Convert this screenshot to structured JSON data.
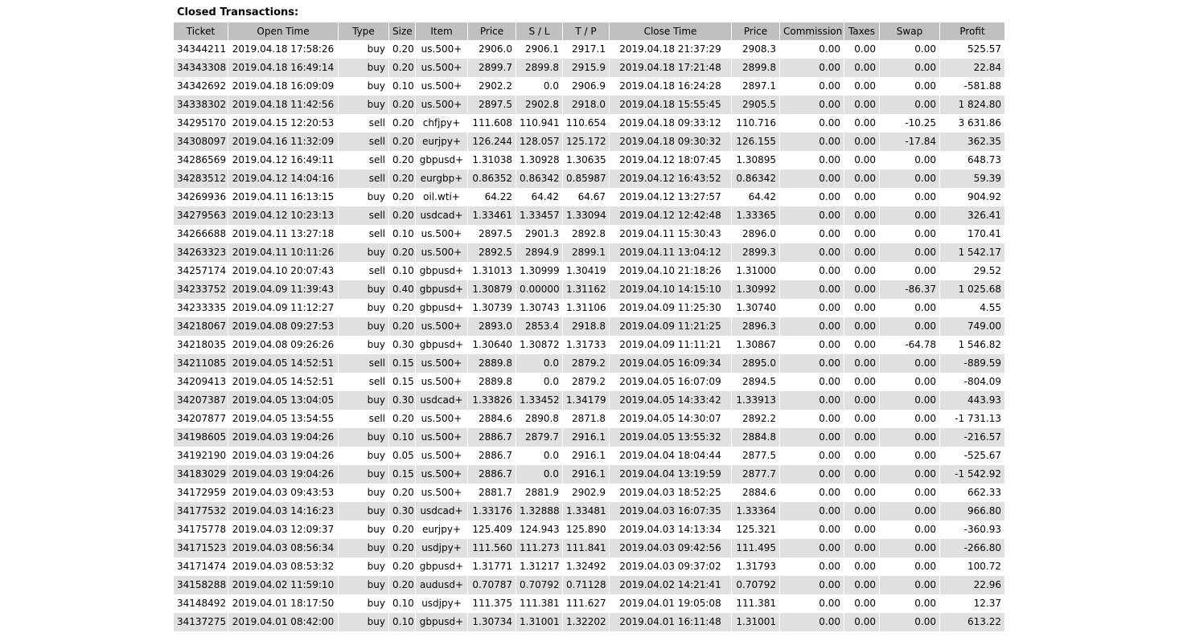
{
  "section_title": "Closed Transactions:",
  "columns": [
    "Ticket",
    "Open Time",
    "Type",
    "Size",
    "Item",
    "Price",
    "S / L",
    "T / P",
    "Close Time",
    "Price",
    "Commission",
    "Taxes",
    "Swap",
    "Profit"
  ],
  "rows": [
    [
      "34344211",
      "2019.04.18 17:58:26",
      "buy",
      "0.20",
      "us.500+",
      "2906.0",
      "2906.1",
      "2917.1",
      "2019.04.18 21:37:29",
      "2908.3",
      "0.00",
      "0.00",
      "0.00",
      "525.57"
    ],
    [
      "34343308",
      "2019.04.18 16:49:14",
      "buy",
      "0.20",
      "us.500+",
      "2899.7",
      "2899.8",
      "2915.9",
      "2019.04.18 17:21:48",
      "2899.8",
      "0.00",
      "0.00",
      "0.00",
      "22.84"
    ],
    [
      "34342692",
      "2019.04.18 16:09:09",
      "buy",
      "0.10",
      "us.500+",
      "2902.2",
      "0.0",
      "2906.9",
      "2019.04.18 16:24:28",
      "2897.1",
      "0.00",
      "0.00",
      "0.00",
      "-581.88"
    ],
    [
      "34338302",
      "2019.04.18 11:42:56",
      "buy",
      "0.20",
      "us.500+",
      "2897.5",
      "2902.8",
      "2918.0",
      "2019.04.18 15:55:45",
      "2905.5",
      "0.00",
      "0.00",
      "0.00",
      "1 824.80"
    ],
    [
      "34295170",
      "2019.04.15 12:20:53",
      "sell",
      "0.20",
      "chfjpy+",
      "111.608",
      "110.941",
      "110.654",
      "2019.04.18 09:33:12",
      "110.716",
      "0.00",
      "0.00",
      "-10.25",
      "3 631.86"
    ],
    [
      "34308097",
      "2019.04.16 11:32:09",
      "sell",
      "0.20",
      "eurjpy+",
      "126.244",
      "128.057",
      "125.172",
      "2019.04.18 09:30:32",
      "126.155",
      "0.00",
      "0.00",
      "-17.84",
      "362.35"
    ],
    [
      "34286569",
      "2019.04.12 16:49:11",
      "sell",
      "0.20",
      "gbpusd+",
      "1.31038",
      "1.30928",
      "1.30635",
      "2019.04.12 18:07:45",
      "1.30895",
      "0.00",
      "0.00",
      "0.00",
      "648.73"
    ],
    [
      "34283512",
      "2019.04.12 14:04:16",
      "sell",
      "0.20",
      "eurgbp+",
      "0.86352",
      "0.86342",
      "0.85987",
      "2019.04.12 16:43:52",
      "0.86342",
      "0.00",
      "0.00",
      "0.00",
      "59.39"
    ],
    [
      "34269936",
      "2019.04.11 16:13:15",
      "buy",
      "0.20",
      "oil.wti+",
      "64.22",
      "64.42",
      "64.67",
      "2019.04.12 13:27:57",
      "64.42",
      "0.00",
      "0.00",
      "0.00",
      "904.92"
    ],
    [
      "34279563",
      "2019.04.12 10:23:13",
      "sell",
      "0.20",
      "usdcad+",
      "1.33461",
      "1.33457",
      "1.33094",
      "2019.04.12 12:42:48",
      "1.33365",
      "0.00",
      "0.00",
      "0.00",
      "326.41"
    ],
    [
      "34266688",
      "2019.04.11 13:27:18",
      "sell",
      "0.10",
      "us.500+",
      "2897.5",
      "2901.3",
      "2892.8",
      "2019.04.11 15:30:43",
      "2896.0",
      "0.00",
      "0.00",
      "0.00",
      "170.41"
    ],
    [
      "34263323",
      "2019.04.11 10:11:26",
      "buy",
      "0.20",
      "us.500+",
      "2892.5",
      "2894.9",
      "2899.1",
      "2019.04.11 13:04:12",
      "2899.3",
      "0.00",
      "0.00",
      "0.00",
      "1 542.17"
    ],
    [
      "34257174",
      "2019.04.10 20:07:43",
      "sell",
      "0.10",
      "gbpusd+",
      "1.31013",
      "1.30999",
      "1.30419",
      "2019.04.10 21:18:26",
      "1.31000",
      "0.00",
      "0.00",
      "0.00",
      "29.52"
    ],
    [
      "34233752",
      "2019.04.09 11:39:43",
      "buy",
      "0.40",
      "gbpusd+",
      "1.30879",
      "0.00000",
      "1.31162",
      "2019.04.10 14:15:10",
      "1.30992",
      "0.00",
      "0.00",
      "-86.37",
      "1 025.68"
    ],
    [
      "34233335",
      "2019.04.09 11:12:27",
      "buy",
      "0.20",
      "gbpusd+",
      "1.30739",
      "1.30743",
      "1.31106",
      "2019.04.09 11:25:30",
      "1.30740",
      "0.00",
      "0.00",
      "0.00",
      "4.55"
    ],
    [
      "34218067",
      "2019.04.08 09:27:53",
      "buy",
      "0.20",
      "us.500+",
      "2893.0",
      "2853.4",
      "2918.8",
      "2019.04.09 11:21:25",
      "2896.3",
      "0.00",
      "0.00",
      "0.00",
      "749.00"
    ],
    [
      "34218035",
      "2019.04.08 09:26:26",
      "buy",
      "0.30",
      "gbpusd+",
      "1.30640",
      "1.30872",
      "1.31733",
      "2019.04.09 11:11:21",
      "1.30867",
      "0.00",
      "0.00",
      "-64.78",
      "1 546.82"
    ],
    [
      "34211085",
      "2019.04.05 14:52:51",
      "sell",
      "0.15",
      "us.500+",
      "2889.8",
      "0.0",
      "2879.2",
      "2019.04.05 16:09:34",
      "2895.0",
      "0.00",
      "0.00",
      "0.00",
      "-889.59"
    ],
    [
      "34209413",
      "2019.04.05 14:52:51",
      "sell",
      "0.15",
      "us.500+",
      "2889.8",
      "0.0",
      "2879.2",
      "2019.04.05 16:07:09",
      "2894.5",
      "0.00",
      "0.00",
      "0.00",
      "-804.09"
    ],
    [
      "34207387",
      "2019.04.05 13:04:05",
      "buy",
      "0.30",
      "usdcad+",
      "1.33826",
      "1.33452",
      "1.34179",
      "2019.04.05 14:33:42",
      "1.33913",
      "0.00",
      "0.00",
      "0.00",
      "443.93"
    ],
    [
      "34207877",
      "2019.04.05 13:54:55",
      "sell",
      "0.20",
      "us.500+",
      "2884.6",
      "2890.8",
      "2871.8",
      "2019.04.05 14:30:07",
      "2892.2",
      "0.00",
      "0.00",
      "0.00",
      "-1 731.13"
    ],
    [
      "34198605",
      "2019.04.03 19:04:26",
      "buy",
      "0.10",
      "us.500+",
      "2886.7",
      "2879.7",
      "2916.1",
      "2019.04.05 13:55:32",
      "2884.8",
      "0.00",
      "0.00",
      "0.00",
      "-216.57"
    ],
    [
      "34192190",
      "2019.04.03 19:04:26",
      "buy",
      "0.05",
      "us.500+",
      "2886.7",
      "0.0",
      "2916.1",
      "2019.04.04 18:04:44",
      "2877.5",
      "0.00",
      "0.00",
      "0.00",
      "-525.67"
    ],
    [
      "34183029",
      "2019.04.03 19:04:26",
      "buy",
      "0.15",
      "us.500+",
      "2886.7",
      "0.0",
      "2916.1",
      "2019.04.04 13:19:59",
      "2877.7",
      "0.00",
      "0.00",
      "0.00",
      "-1 542.92"
    ],
    [
      "34172959",
      "2019.04.03 09:43:53",
      "buy",
      "0.20",
      "us.500+",
      "2881.7",
      "2881.9",
      "2902.9",
      "2019.04.03 18:52:25",
      "2884.6",
      "0.00",
      "0.00",
      "0.00",
      "662.33"
    ],
    [
      "34177532",
      "2019.04.03 14:16:23",
      "buy",
      "0.30",
      "usdcad+",
      "1.33176",
      "1.32888",
      "1.33481",
      "2019.04.03 16:07:35",
      "1.33364",
      "0.00",
      "0.00",
      "0.00",
      "966.80"
    ],
    [
      "34175778",
      "2019.04.03 12:09:37",
      "buy",
      "0.20",
      "eurjpy+",
      "125.409",
      "124.943",
      "125.890",
      "2019.04.03 14:13:34",
      "125.321",
      "0.00",
      "0.00",
      "0.00",
      "-360.93"
    ],
    [
      "34171523",
      "2019.04.03 08:56:34",
      "buy",
      "0.20",
      "usdjpy+",
      "111.560",
      "111.273",
      "111.841",
      "2019.04.03 09:42:56",
      "111.495",
      "0.00",
      "0.00",
      "0.00",
      "-266.80"
    ],
    [
      "34171474",
      "2019.04.03 08:53:32",
      "buy",
      "0.20",
      "gbpusd+",
      "1.31771",
      "1.31217",
      "1.32492",
      "2019.04.03 09:37:02",
      "1.31793",
      "0.00",
      "0.00",
      "0.00",
      "100.72"
    ],
    [
      "34158288",
      "2019.04.02 11:59:10",
      "buy",
      "0.20",
      "audusd+",
      "0.70787",
      "0.70792",
      "0.71128",
      "2019.04.02 14:21:41",
      "0.70792",
      "0.00",
      "0.00",
      "0.00",
      "22.96"
    ],
    [
      "34148492",
      "2019.04.01 18:17:50",
      "buy",
      "0.10",
      "usdjpy+",
      "111.375",
      "111.381",
      "111.627",
      "2019.04.01 19:05:08",
      "111.381",
      "0.00",
      "0.00",
      "0.00",
      "12.37"
    ],
    [
      "34137275",
      "2019.04.01 08:42:00",
      "buy",
      "0.10",
      "gbpusd+",
      "1.30734",
      "1.31001",
      "1.32202",
      "2019.04.01 16:11:48",
      "1.31001",
      "0.00",
      "0.00",
      "0.00",
      "613.22"
    ]
  ]
}
